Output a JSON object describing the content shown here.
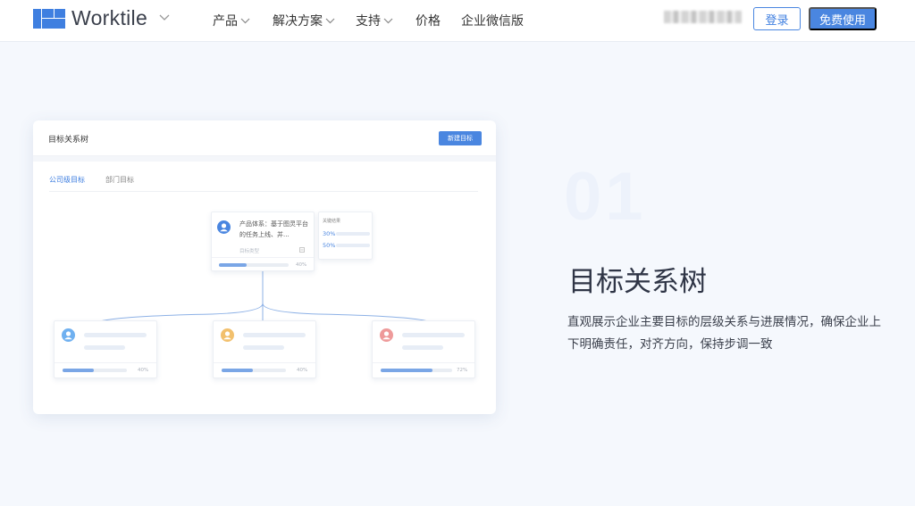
{
  "nav": {
    "brand": "Worktile",
    "items": [
      "产品",
      "解决方案",
      "支持",
      "价格",
      "企业微信版"
    ],
    "login": "登录",
    "free_trial": "免费使用"
  },
  "card": {
    "title": "目标关系树",
    "new_button": "新建目标",
    "tabs": [
      "公司级目标",
      "部门目标"
    ],
    "root": {
      "text": "产品体系：基于图灵平台的任务上线、并...",
      "meta": "目标类型",
      "progress": "40%",
      "progress_value": 0.4
    },
    "key_results": {
      "title": "关键结果",
      "rows": [
        "30%",
        "50%"
      ]
    },
    "children": [
      {
        "progress": "40%",
        "progress_value": 0.4
      },
      {
        "progress": "40%",
        "progress_value": 0.4
      },
      {
        "progress": "72%",
        "progress_value": 0.72
      }
    ]
  },
  "feature": {
    "number": "01",
    "title": "目标关系树",
    "description": "直观展示企业主要目标的层级关系与进展情况，确保企业上下明确责任，对齐方向，保持步调一致"
  },
  "colors": {
    "accent": "#4a86e0",
    "background": "#f5f8fd"
  }
}
